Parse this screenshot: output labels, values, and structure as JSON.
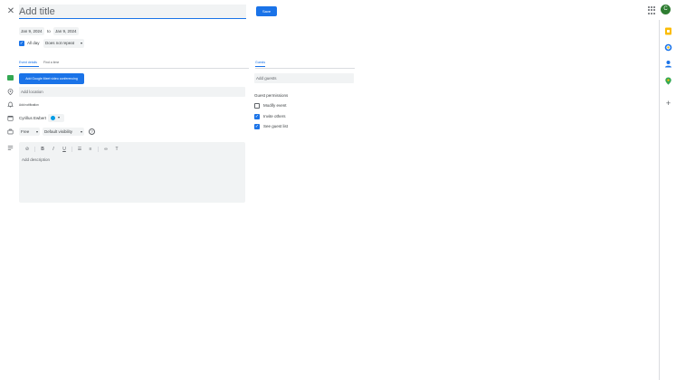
{
  "header": {
    "close_icon": "close-icon",
    "title_placeholder": "Add title",
    "save_label": "Save",
    "apps_icon": "apps-grid-icon",
    "avatar_initial": "C"
  },
  "event": {
    "start_date": "Jan 9, 2024",
    "to_label": "to",
    "end_date": "Jan 9, 2024",
    "all_day_label": "All day",
    "all_day_checked": true,
    "repeat_value": "Does not repeat"
  },
  "tabs": {
    "details": "Event details",
    "find_time": "Find a time",
    "guests": "Guests"
  },
  "details": {
    "meet_button": "Add Google Meet video conferencing",
    "location_placeholder": "Add location",
    "add_notification": "Add notification",
    "calendar_name": "Cyrillus Ewbert",
    "calendar_color": "#039be5",
    "availability_value": "Free",
    "visibility_value": "Default visibility",
    "description_placeholder": "Add description"
  },
  "toolbar": {
    "items": [
      "attachment-icon",
      "bold-icon",
      "italic-icon",
      "underline-icon",
      "numbered-list-icon",
      "bulleted-list-icon",
      "link-icon",
      "remove-formatting-icon"
    ]
  },
  "guests": {
    "input_placeholder": "Add guests",
    "permissions_title": "Guest permissions",
    "permissions": [
      {
        "label": "Modify event",
        "checked": false
      },
      {
        "label": "Invite others",
        "checked": true
      },
      {
        "label": "See guest list",
        "checked": true
      }
    ]
  },
  "side_panel": {
    "icons": [
      "keep-icon",
      "tasks-icon",
      "contacts-icon",
      "maps-icon",
      "add-icon"
    ],
    "colors": {
      "keep": "#fbbc04",
      "tasks": "#1a73e8",
      "contacts": "#1a73e8",
      "maps": "#34a853"
    }
  },
  "colors": {
    "accent": "#1a73e8",
    "field_bg": "#f1f3f4",
    "meet_green": "#34a853",
    "avatar_bg": "#2e7d32"
  }
}
